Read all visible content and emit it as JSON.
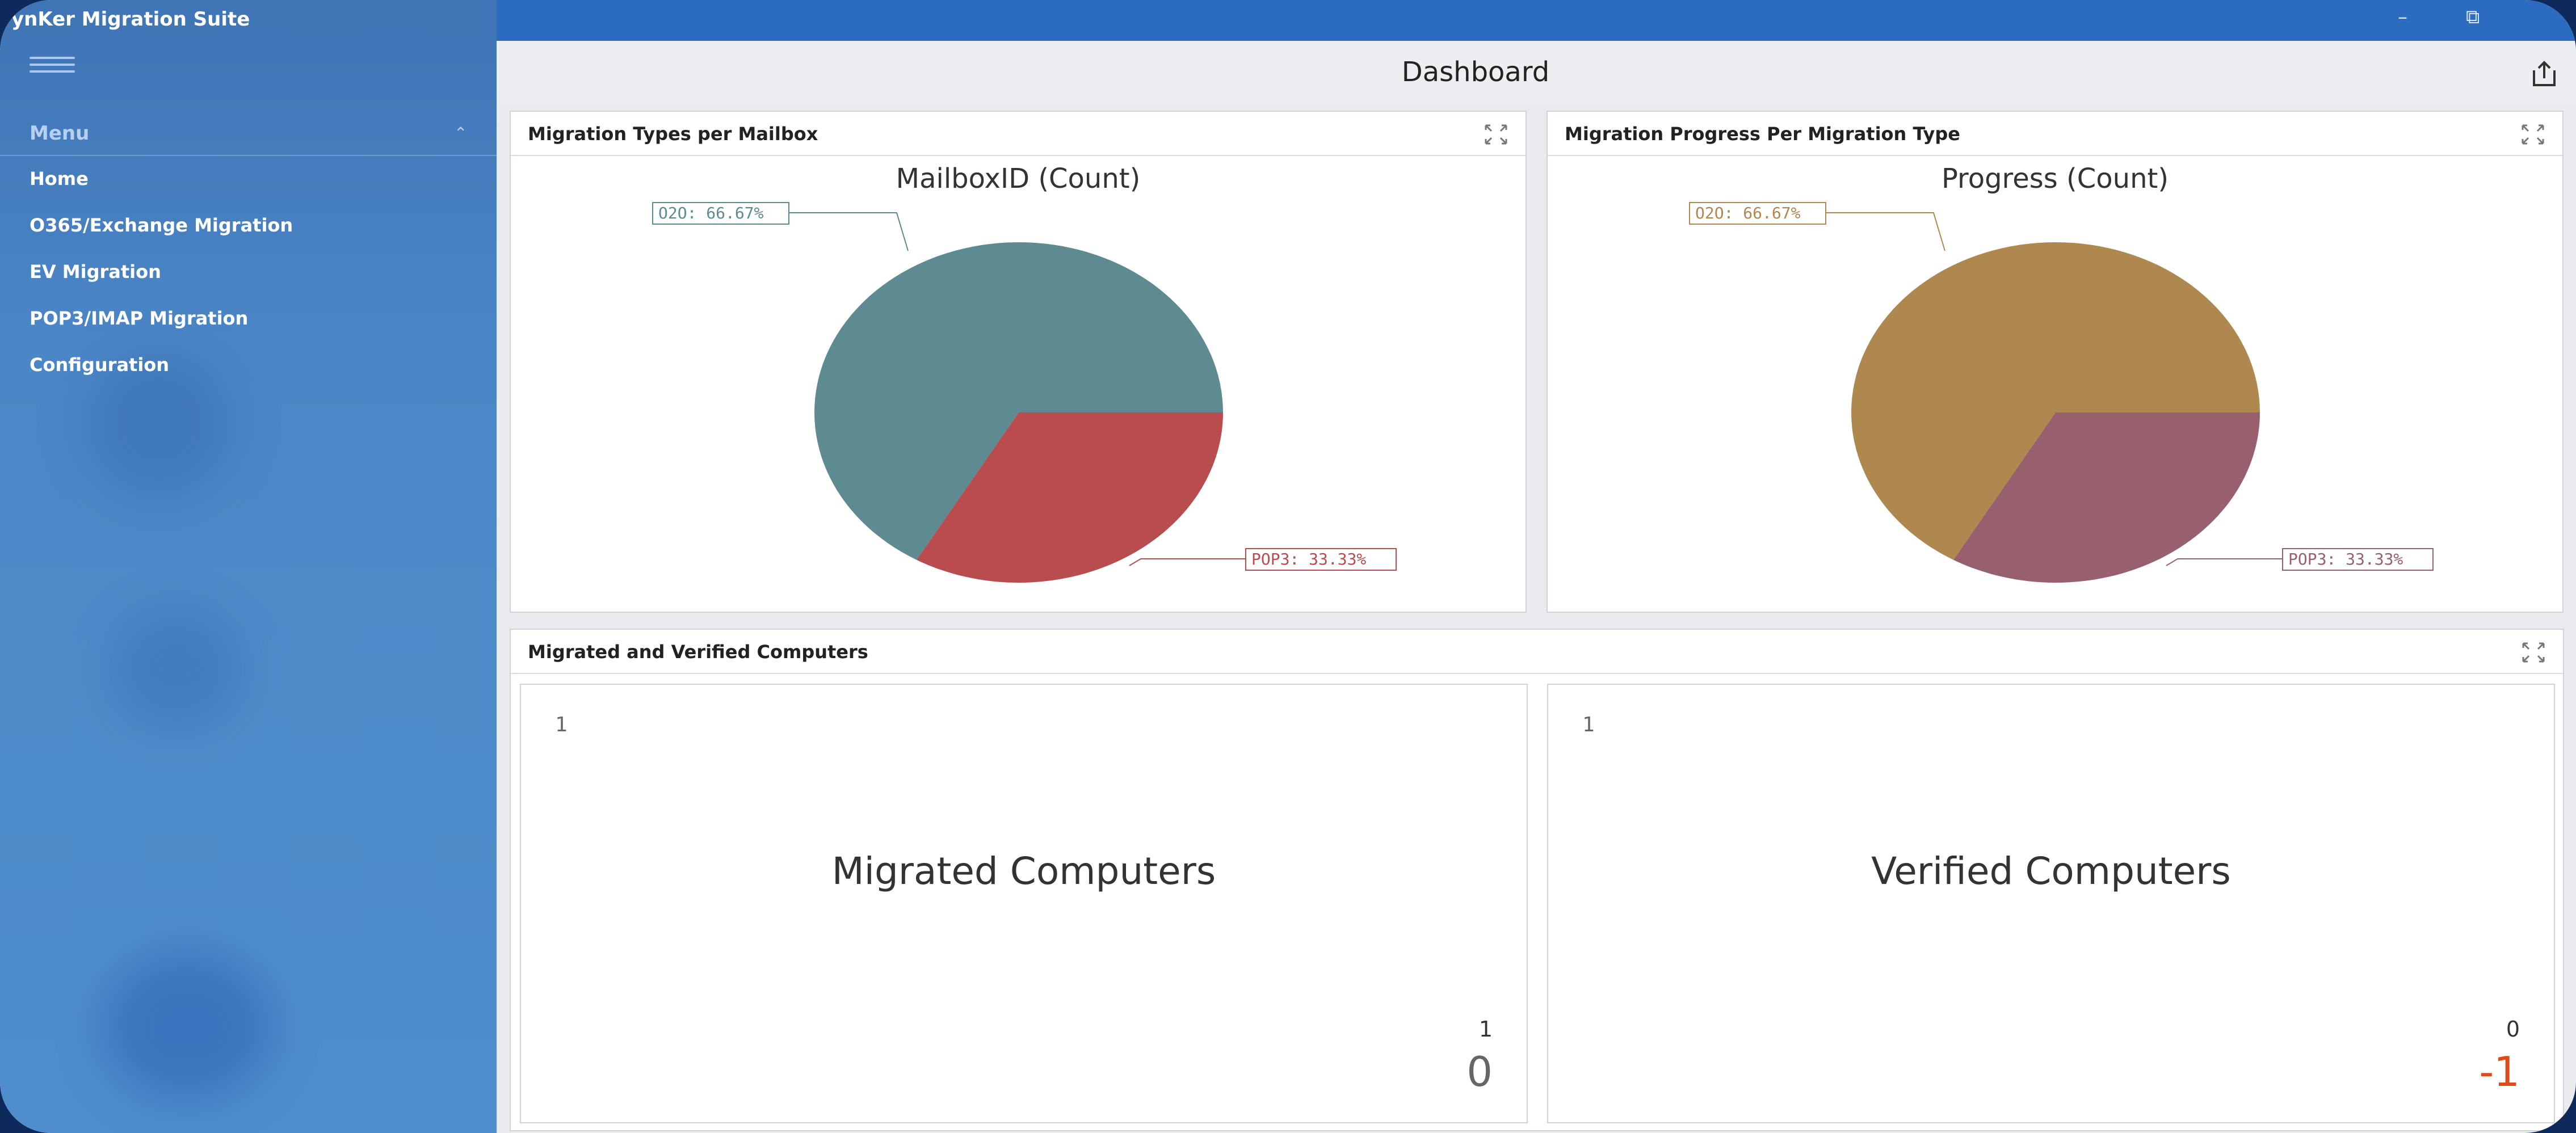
{
  "app": {
    "title": "ynKer Migration Suite"
  },
  "sidebar": {
    "menu_label": "Menu",
    "items": [
      {
        "label": "Home"
      },
      {
        "label": "O365/Exchange Migration"
      },
      {
        "label": "EV Migration"
      },
      {
        "label": "POP3/IMAP Migration"
      },
      {
        "label": "Configuration"
      }
    ]
  },
  "window": {
    "minimize": "–",
    "restore": "⧉"
  },
  "header": {
    "title": "Dashboard"
  },
  "panels": {
    "types": {
      "title": "Migration Types per Mailbox"
    },
    "progress": {
      "title": "Migration Progress Per Migration Type"
    },
    "computers": {
      "title": "Migrated and Verified Computers"
    }
  },
  "chart_data": [
    {
      "type": "pie",
      "title": "MailboxID (Count)",
      "categories": [
        "O2O",
        "POP3"
      ],
      "values": [
        66.67,
        33.33
      ],
      "labels": [
        "O2O: 66.67%",
        "POP3: 33.33%"
      ],
      "colors": [
        "#5e8a91",
        "#b84c4e"
      ]
    },
    {
      "type": "pie",
      "title": "Progress (Count)",
      "categories": [
        "O2O",
        "POP3"
      ],
      "values": [
        66.67,
        33.33
      ],
      "labels": [
        "O2O: 66.67%",
        "POP3: 33.33%"
      ],
      "colors": [
        "#ae884f",
        "#985f6f"
      ]
    }
  ],
  "cards": {
    "migrated": {
      "small": "1",
      "label": "Migrated Computers",
      "target": "1",
      "value": "0",
      "value_color": "#666666"
    },
    "verified": {
      "small": "1",
      "label": "Verified Computers",
      "target": "0",
      "value": "-1",
      "value_color": "#e04a16"
    }
  }
}
